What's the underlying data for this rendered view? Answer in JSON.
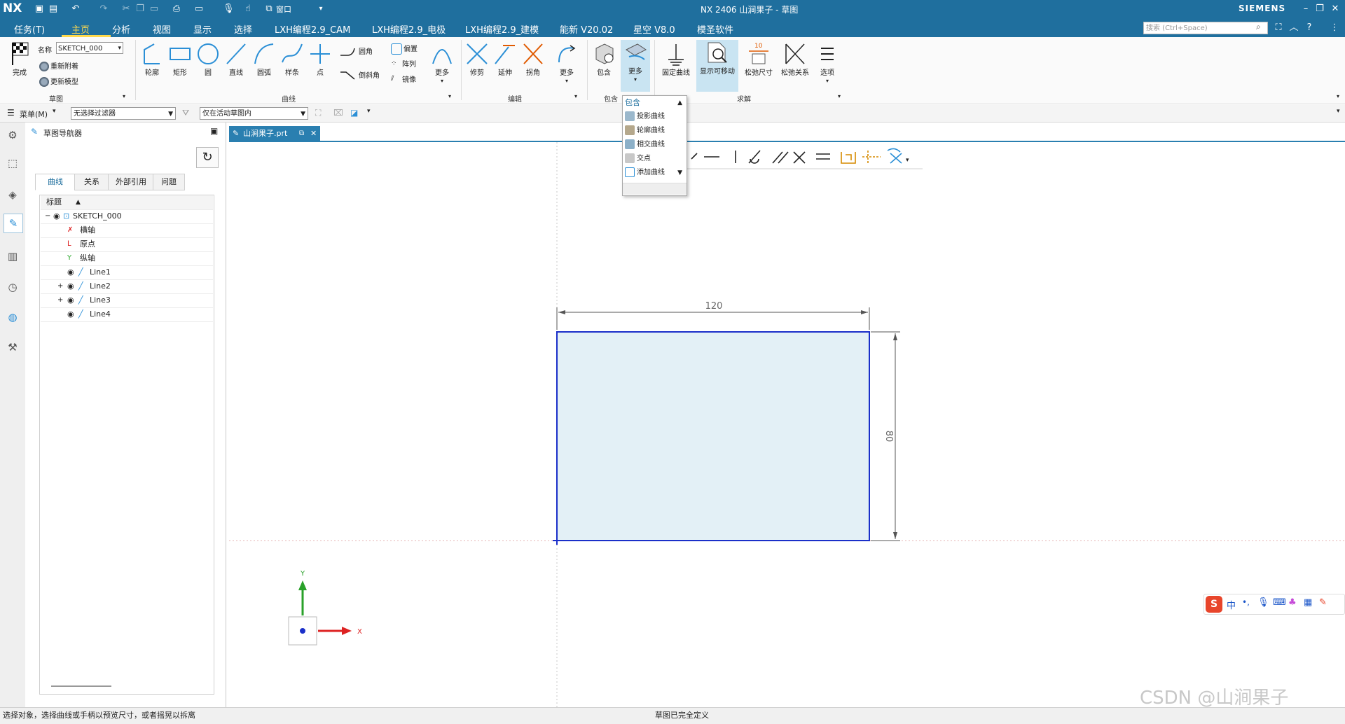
{
  "app": {
    "logo": "NX",
    "title": "NX 2406 山涧果子 - 草图",
    "brand": "SIEMENS",
    "window_menu": "窗口"
  },
  "menubar": {
    "items": [
      "任务(T)",
      "主页",
      "分析",
      "视图",
      "显示",
      "选择",
      "LXH编程2.9_CAM",
      "LXH编程2.9_电极",
      "LXH编程2.9_建模",
      "能新 V20.02",
      "星空 V8.0",
      "模圣软件"
    ],
    "active": "主页",
    "search_placeholder": "搜索 (Ctrl+Space)"
  },
  "ribbon": {
    "finish": "完成",
    "name_label": "名称",
    "name_value": "SKETCH_000",
    "reattach": "重新附着",
    "update_model": "更新模型",
    "group_sketch": "草图",
    "curve_tools": [
      "轮廓",
      "矩形",
      "圆",
      "直线",
      "圆弧",
      "样条",
      "点"
    ],
    "fillet": "圆角",
    "chamfer": "倒斜角",
    "offset": "偏置",
    "pattern": "阵列",
    "mirror": "镜像",
    "more": "更多",
    "group_curve": "曲线",
    "edit_tools": [
      "修剪",
      "延伸",
      "拐角"
    ],
    "group_edit": "编辑",
    "include": "包含",
    "group_include": "包含",
    "fix_curve": "固定曲线",
    "show_movable": "显示可移动",
    "relax_dim": "松弛尺寸",
    "relax_rel": "松弛关系",
    "options": "选项",
    "group_solve": "求解",
    "dim_badge": "10"
  },
  "toolbar": {
    "menu": "菜单(M)",
    "filter": "无选择过滤器",
    "scope": "仅在活动草图内"
  },
  "navigator": {
    "title": "草图导航器",
    "tabs": [
      "曲线",
      "关系",
      "外部引用",
      "问题"
    ],
    "column_header": "标题",
    "rows": [
      {
        "label": "SKETCH_000",
        "level": 0,
        "expander": "−"
      },
      {
        "label": "横轴",
        "level": 1,
        "expander": ""
      },
      {
        "label": "原点",
        "level": 1,
        "expander": ""
      },
      {
        "label": "纵轴",
        "level": 1,
        "expander": ""
      },
      {
        "label": "Line1",
        "level": 2,
        "expander": ""
      },
      {
        "label": "Line2",
        "level": 2,
        "expander": "+"
      },
      {
        "label": "Line3",
        "level": 2,
        "expander": "+"
      },
      {
        "label": "Line4",
        "level": 2,
        "expander": ""
      }
    ]
  },
  "document_tab": {
    "label": "山涧果子.prt"
  },
  "popup_menu": {
    "header": "包含",
    "items": [
      "投影曲线",
      "轮廓曲线",
      "相交曲线",
      "交点",
      "添加曲线"
    ]
  },
  "sketch": {
    "width_dim": "120",
    "height_dim": "80",
    "axis_x": "X",
    "axis_y": "Y",
    "fill_color": "#e3f0f6",
    "stroke_color": "#1a2fc9"
  },
  "ime": {
    "label": "中"
  },
  "status": {
    "left": "选择对象，选择曲线或手柄以预览尺寸，或者摇晃以拆离",
    "center": "草图已完全定义"
  },
  "watermark": "CSDN @山涧果子"
}
